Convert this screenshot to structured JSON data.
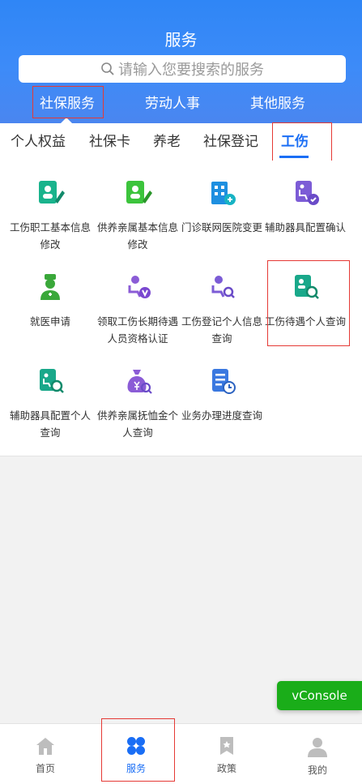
{
  "header": {
    "title": "服务",
    "search_placeholder": "请输入您要搜索的服务",
    "categories": [
      "社保服务",
      "劳动人事",
      "其他服务"
    ]
  },
  "subtabs": [
    "个人权益",
    "社保卡",
    "养老",
    "社保登记",
    "工伤"
  ],
  "services": [
    {
      "label": "工伤职工基本信息修改",
      "icon": "edit-person-icon",
      "color": "#19b38c"
    },
    {
      "label": "供养亲属基本信息修改",
      "icon": "edit-person-icon",
      "color": "#3cc43c"
    },
    {
      "label": "门诊联网医院变更",
      "icon": "hospital-icon",
      "color": "#1e8fe0"
    },
    {
      "label": "辅助器具配置确认",
      "icon": "wheelchair-check-icon",
      "color": "#7c5cd6"
    },
    {
      "label": "就医申请",
      "icon": "doctor-icon",
      "color": "#3aa83a"
    },
    {
      "label": "领取工伤长期待遇人员资格认证",
      "icon": "certify-icon",
      "color": "#8b5cd6"
    },
    {
      "label": "工伤登记个人信息查询",
      "icon": "search-person-icon",
      "color": "#7c5cd6"
    },
    {
      "label": "工伤待遇个人查询",
      "icon": "search-doc-icon",
      "color": "#19a88a"
    },
    {
      "label": "辅助器具配置个人查询",
      "icon": "search-doc-icon",
      "color": "#19a88a"
    },
    {
      "label": "供养亲属抚恤金个人查询",
      "icon": "money-bag-icon",
      "color": "#8b5cd6"
    },
    {
      "label": "业务办理进度查询",
      "icon": "progress-doc-icon",
      "color": "#3a78e0"
    }
  ],
  "vconsole_label": "vConsole",
  "nav": [
    "首页",
    "服务",
    "政策",
    "我的"
  ],
  "colors": {
    "accent": "#1a6ef5",
    "header": "#3d8bf8",
    "highlight_box": "#e53935",
    "vconsole": "#1aad19"
  }
}
